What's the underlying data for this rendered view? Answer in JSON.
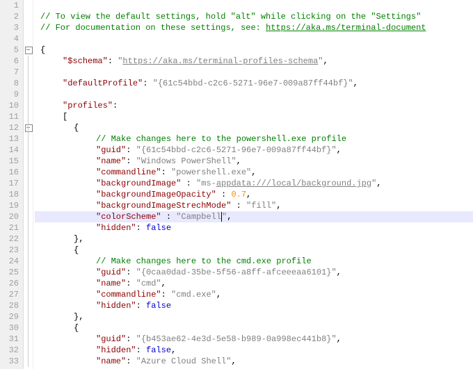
{
  "lines": {
    "1": "1",
    "2": "2",
    "3": "3",
    "4": "4",
    "5": "5",
    "6": "6",
    "7": "7",
    "8": "8",
    "9": "9",
    "10": "10",
    "11": "11",
    "12": "12",
    "13": "13",
    "14": "14",
    "15": "15",
    "16": "16",
    "17": "17",
    "18": "18",
    "19": "19",
    "20": "20",
    "21": "21",
    "22": "22",
    "23": "23",
    "24": "24",
    "25": "25",
    "26": "26",
    "27": "27",
    "28": "28",
    "29": "29",
    "30": "30",
    "31": "31",
    "32": "32",
    "33": "33"
  },
  "c": {
    "top1": "// To view the default settings, hold \"alt\" while clicking on the \"Settings\"",
    "top2a": "// For documentation on these settings, see: ",
    "top2b": "https://aka.ms/terminal-document",
    "schemaKey": "\"$schema\"",
    "schemaUrl": "https://aka.ms/terminal-profiles-schema",
    "defaultProfileKey": "\"defaultProfile\"",
    "defaultProfileVal": "\"{61c54bbd-c2c6-5271-96e7-009a87ff44bf}\"",
    "profilesKey": "\"profiles\"",
    "lbrace": "{",
    "rbraceComma": "},",
    "lbrack": "[",
    "comma": ",",
    "colon": ": ",
    "colonSp": " : ",
    "ps_comment": "// Make changes here to the powershell.exe profile",
    "guidKey": "\"guid\"",
    "ps_guid": "\"{61c54bbd-c2c6-5271-96e7-009a87ff44bf}\"",
    "nameKey": "\"name\"",
    "ps_name": "\"Windows PowerShell\"",
    "cmdlineKey": "\"commandline\"",
    "ps_cmdline": "\"powershell.exe\"",
    "bgImgKey": "\"backgroundImage\"",
    "bgImgPre": "\"ms-",
    "bgImgLink": "appdata:///local/background.jpg",
    "bgImgPost": "\"",
    "bgOpKey": "\"backgroundImageOpacity\"",
    "bgOpVal": "0.7",
    "bgStretchKey": "\"backgroundImageStrechMode\"",
    "bgStretchVal": "\"fill\"",
    "colorSchemeKey": "\"colorScheme\"",
    "colorSchemeValPre": "\"Campbell",
    "colorSchemeValPost": "\"",
    "hiddenKey": "\"hidden\"",
    "falseKw": "false",
    "cmd_comment": "// Make changes here to the cmd.exe profile",
    "cmd_guid": "\"{0caa0dad-35be-5f56-a8ff-afceeeaa6101}\"",
    "cmd_name": "\"cmd\"",
    "cmd_cmdline": "\"cmd.exe\"",
    "az_guid": "\"{b453ae62-4e3d-5e58-b989-0a998ec441b8}\"",
    "az_name": "\"Azure Cloud Shell\""
  }
}
